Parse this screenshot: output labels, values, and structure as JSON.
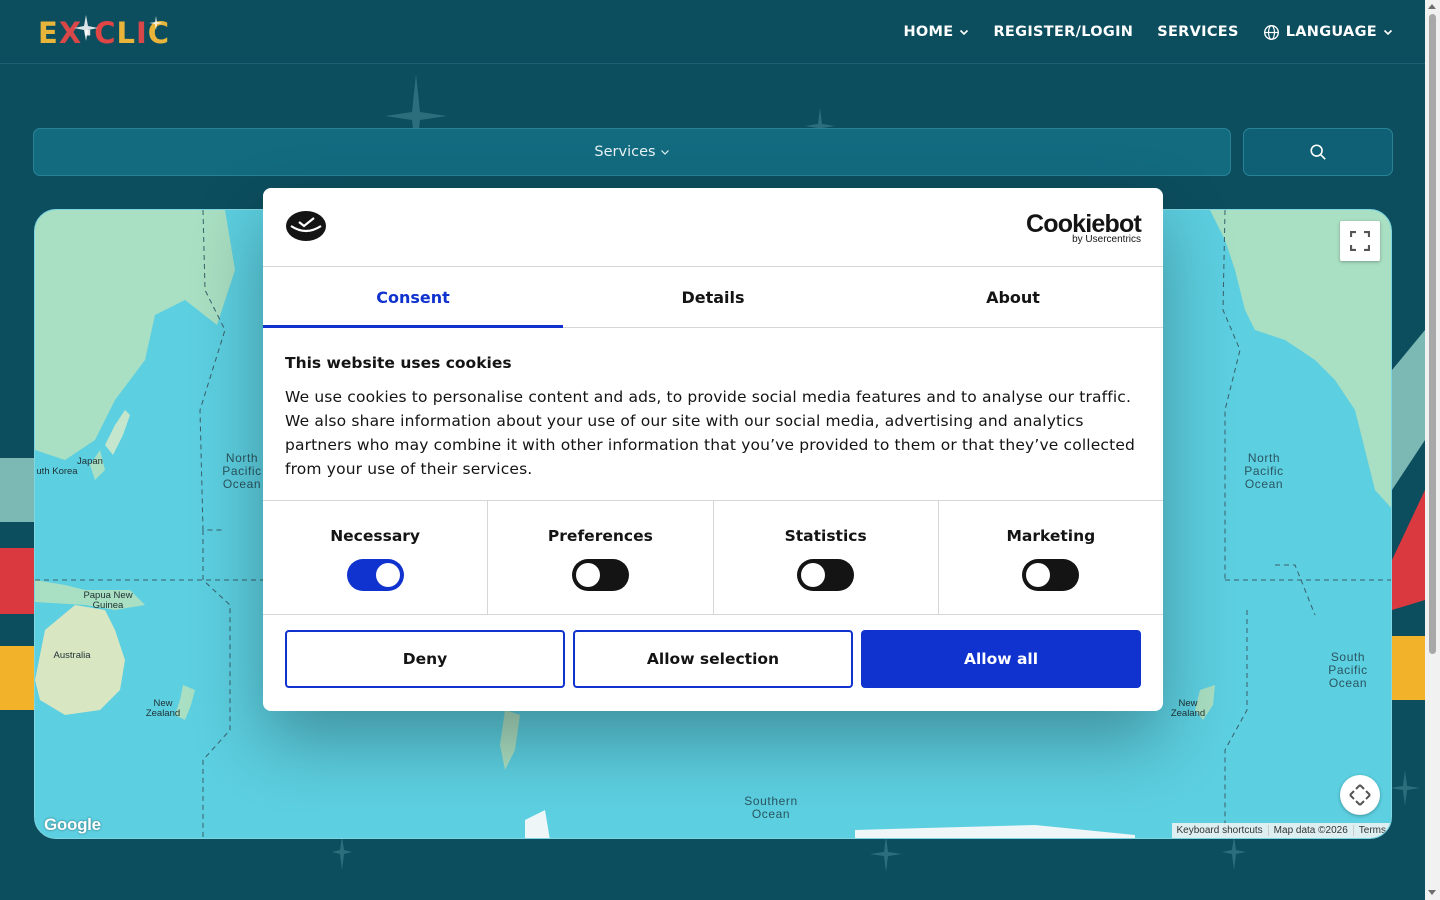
{
  "header": {
    "logo_text": "EXCLIC",
    "nav": [
      {
        "label": "HOME",
        "has_dropdown": true
      },
      {
        "label": "REGISTER/LOGIN",
        "has_dropdown": false
      },
      {
        "label": "SERVICES",
        "has_dropdown": false
      },
      {
        "label": "LANGUAGE",
        "has_dropdown": true,
        "icon": "globe-icon"
      }
    ]
  },
  "search": {
    "select_label": "Services",
    "button_icon": "search-icon"
  },
  "map": {
    "ocean_labels": {
      "north_pacific_left": "North Pacific Ocean",
      "north_pacific_right": "North Pacific Ocean",
      "south_pacific": "South Pacific Ocean",
      "southern": "Southern Ocean"
    },
    "land_labels": {
      "japan": "Japan",
      "south_korea": "uth Korea",
      "png": "Papua New Guinea",
      "australia": "Australia",
      "nz_left": "New Zealand",
      "nz_right": "New Zealand"
    },
    "google": "Google",
    "attribution": [
      "Keyboard shortcuts",
      "Map data ©2026",
      "Terms"
    ],
    "colors": {
      "ocean": "#5ccfe0",
      "land": "#a8e0c4"
    }
  },
  "cookie_dialog": {
    "brand_name": "Cookiebot",
    "brand_sub": "by Usercentrics",
    "tabs": [
      {
        "label": "Consent",
        "active": true
      },
      {
        "label": "Details",
        "active": false
      },
      {
        "label": "About",
        "active": false
      }
    ],
    "title": "This website uses cookies",
    "text": "We use cookies to personalise content and ads, to provide social media features and to analyse our traffic. We also share information about your use of our site with our social media, advertising and analytics partners who may combine it with other information that you’ve provided to them or that they’ve collected from your use of their services.",
    "toggles": [
      {
        "label": "Necessary",
        "on": true
      },
      {
        "label": "Preferences",
        "on": false
      },
      {
        "label": "Statistics",
        "on": false
      },
      {
        "label": "Marketing",
        "on": false
      }
    ],
    "buttons": {
      "deny": "Deny",
      "allow_selection": "Allow selection",
      "allow_all": "Allow all"
    },
    "accent_color": "#1032cf"
  }
}
